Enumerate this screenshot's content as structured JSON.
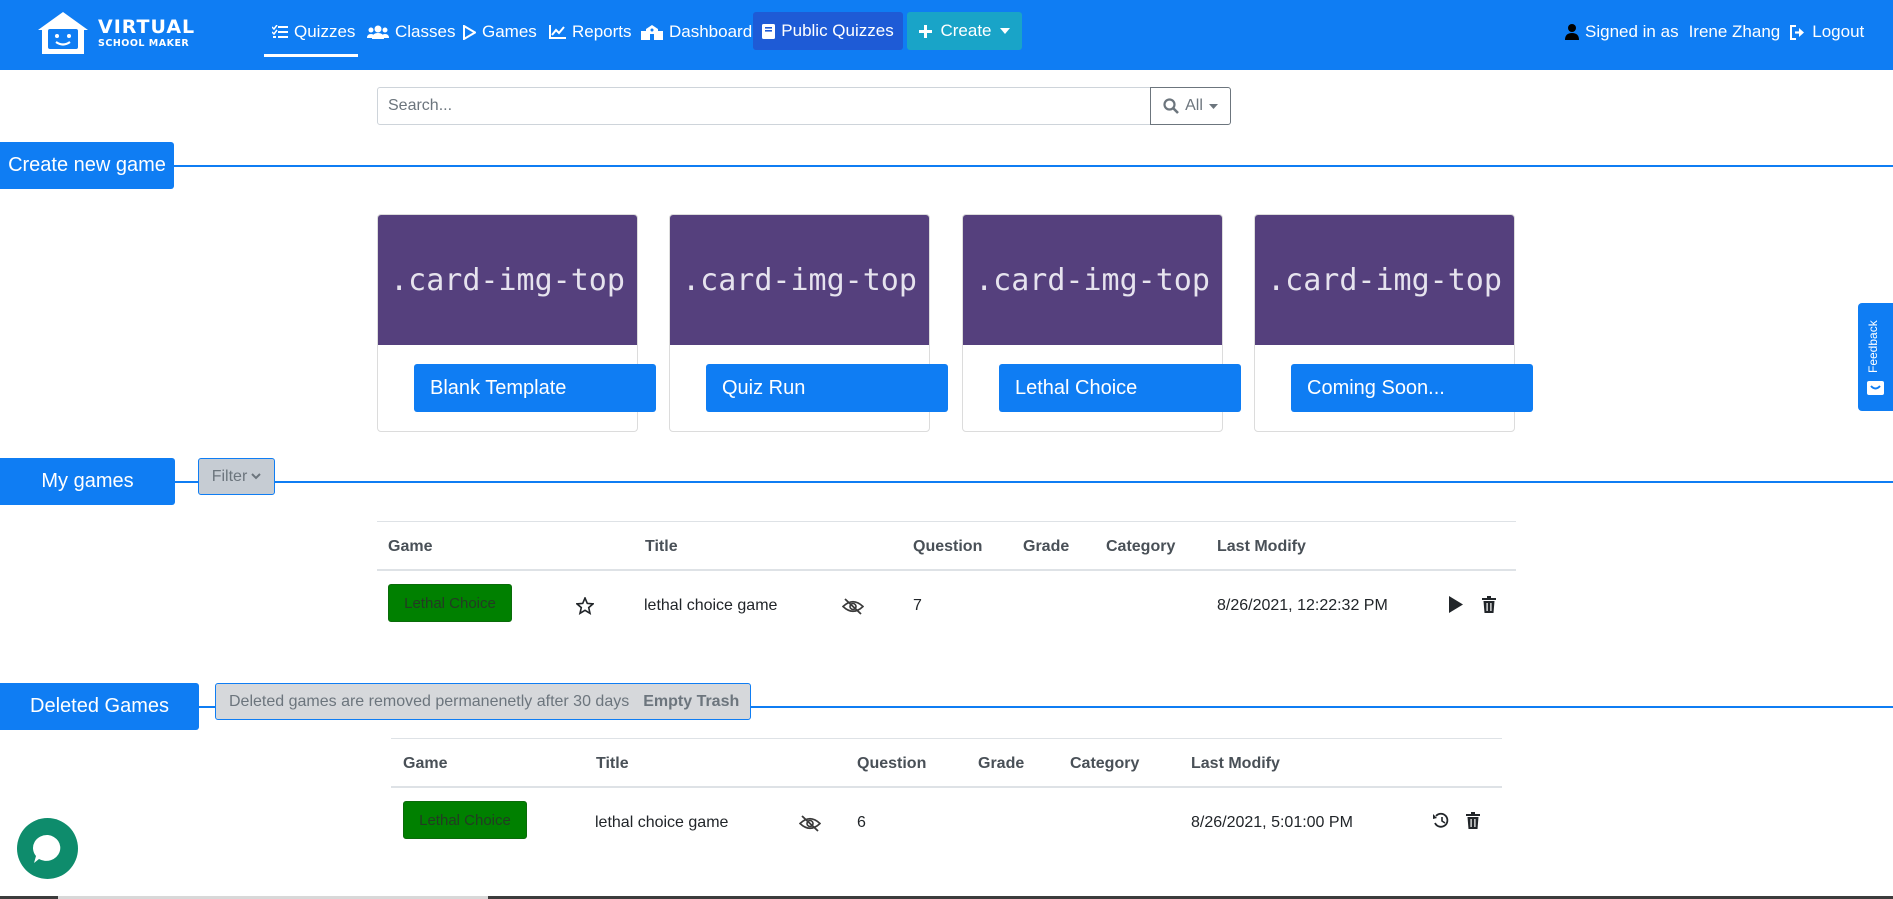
{
  "brand": {
    "line1": "VIRTUAL",
    "line2": "SCHOOL MAKER"
  },
  "nav": {
    "quizzes": "Quizzes",
    "classes": "Classes",
    "games": "Games",
    "reports": "Reports",
    "dashboard": "Dashboard",
    "public_quizzes": "Public Quizzes",
    "create": "Create"
  },
  "user": {
    "signed_in_label": "Signed in as",
    "name": "Irene Zhang",
    "logout": "Logout"
  },
  "search": {
    "placeholder": "Search...",
    "scope": "All"
  },
  "create_section": {
    "title": "Create new game",
    "cards": [
      {
        "image_text": ".card-img-top",
        "button": "Blank Template"
      },
      {
        "image_text": ".card-img-top",
        "button": "Quiz Run"
      },
      {
        "image_text": ".card-img-top",
        "button": "Lethal Choice"
      },
      {
        "image_text": ".card-img-top",
        "button": "Coming Soon..."
      }
    ]
  },
  "feedback": {
    "label": "Feedback"
  },
  "my_games": {
    "title": "My games",
    "filter": "Filter",
    "columns": {
      "game": "Game",
      "title": "Title",
      "question": "Question",
      "grade": "Grade",
      "category": "Category",
      "last_modify": "Last Modify"
    },
    "rows": [
      {
        "game": "Lethal Choice",
        "title": "lethal choice game",
        "question": "7",
        "grade": "",
        "category": "",
        "last_modify": "8/26/2021, 12:22:32 PM"
      }
    ]
  },
  "deleted_games": {
    "title": "Deleted Games",
    "note": "Deleted games are removed permanenetly after 30 days",
    "empty_trash": "Empty Trash",
    "columns": {
      "game": "Game",
      "title": "Title",
      "question": "Question",
      "grade": "Grade",
      "category": "Category",
      "last_modify": "Last Modify"
    },
    "rows": [
      {
        "game": "Lethal Choice",
        "title": "lethal choice game",
        "question": "6",
        "grade": "",
        "category": "",
        "last_modify": "8/26/2021, 5:01:00 PM"
      }
    ]
  },
  "colors": {
    "primary": "#0f7df3",
    "card_image": "#55407d",
    "game_badge": "#008000",
    "chat": "#0e8c6c"
  }
}
